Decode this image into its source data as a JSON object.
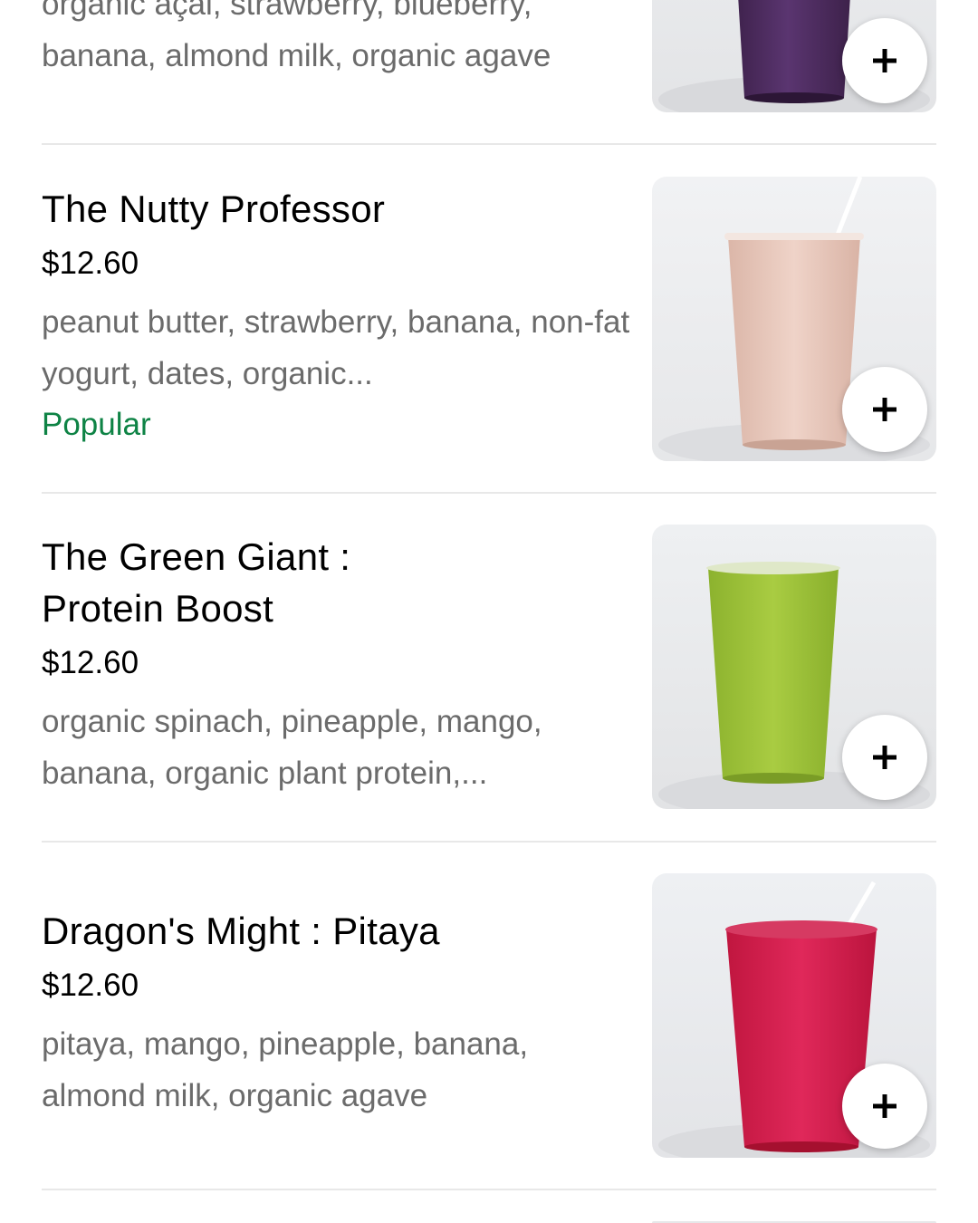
{
  "items": [
    {
      "name": "",
      "price": "",
      "description_lines": [
        "organic açai, strawberry, blueberry,",
        "banana, almond milk, organic agave"
      ],
      "badge": "",
      "drink_color": "#4b2a5c"
    },
    {
      "name": "The Nutty Professor",
      "price": "$12.60",
      "description": "peanut butter, strawberry, banana, non-fat yogurt, dates, organic...",
      "badge": "Popular",
      "drink_color": "#e9c8bc"
    },
    {
      "name_lines": [
        "The Green Giant :",
        "Protein Boost"
      ],
      "price": "$12.60",
      "description": "organic spinach, pineapple, mango, banana, organic plant protein,...",
      "badge": "",
      "drink_color": "#a4c83e"
    },
    {
      "name": "Dragon's Might : Pitaya",
      "price": "$12.60",
      "description": "pitaya, mango, pineapple, banana, almond milk, organic agave",
      "badge": "",
      "drink_color": "#d81f4e"
    }
  ],
  "add_icon": "plus-icon",
  "colors": {
    "badge": "#0e8345",
    "description": "#6b6b6b",
    "divider": "#e8e8e8"
  }
}
